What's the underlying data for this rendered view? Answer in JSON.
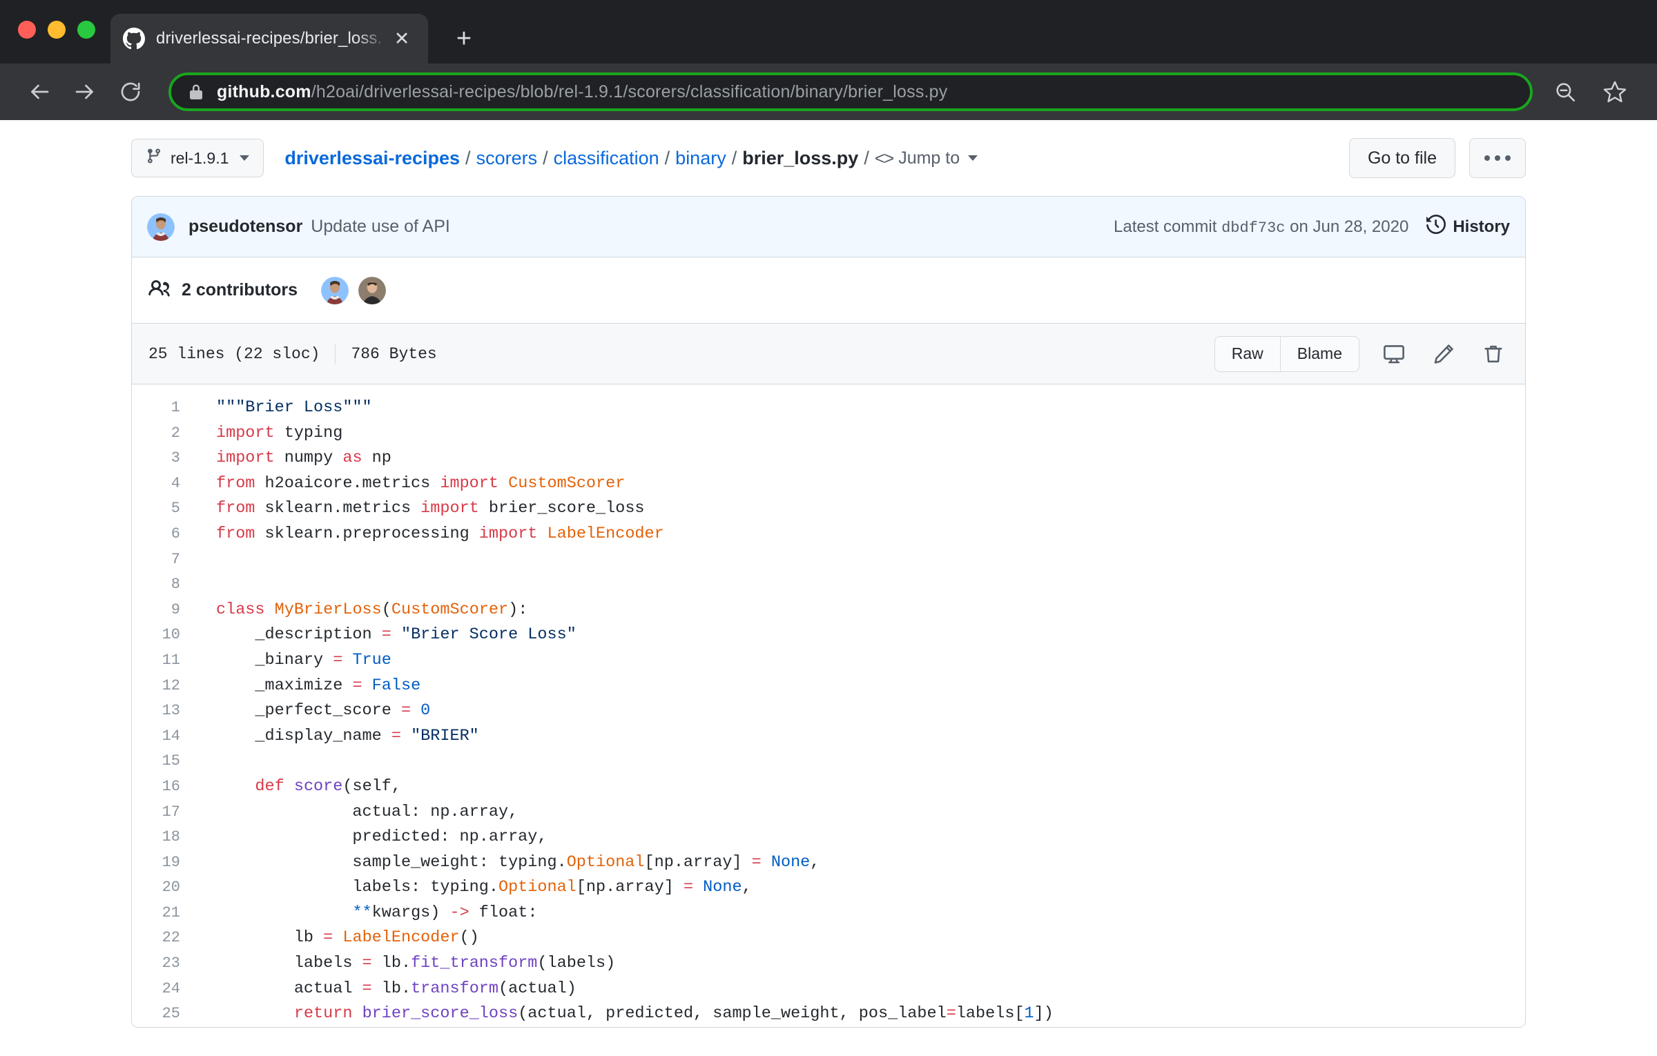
{
  "browser": {
    "tab": {
      "title": "driverlessai-recipes/brier_loss.",
      "favicon_name": "github-favicon",
      "close_label": "✕"
    },
    "new_tab_label": "+",
    "nav": {
      "back": "←",
      "forward": "→",
      "reload": "⟳"
    },
    "omnibox": {
      "host": "github.com",
      "path": "/h2oai/driverlessai-recipes/blob/rel-1.9.1/scorers/classification/binary/brier_loss.py",
      "lock_icon": "lock-icon",
      "highlight_color": "#19a51e"
    },
    "toolbar_icons": [
      "zoom-out-icon",
      "bookmark-star-icon"
    ]
  },
  "page": {
    "branch_selector": {
      "label": "rel-1.9.1",
      "icon": "branch-icon"
    },
    "breadcrumb": {
      "repo": "driverlessai-recipes",
      "segments": [
        "scorers",
        "classification",
        "binary"
      ],
      "file": "brier_loss.py",
      "separator": "/",
      "jump_to": "Jump to"
    },
    "actions": {
      "go_to_file": "Go to file",
      "more": "…"
    },
    "commit": {
      "author": "pseudotensor",
      "message": "Update use of API",
      "latest_commit_prefix": "Latest commit",
      "sha": "dbdf73c",
      "date": "on Jun 28, 2020",
      "history_label": "History"
    },
    "contributors": {
      "count_label": "2 contributors",
      "icon": "people-icon"
    },
    "file_meta": {
      "lines": "25 lines (22 sloc)",
      "size": "786 Bytes",
      "raw": "Raw",
      "blame": "Blame",
      "desktop_icon": "desktop-download-icon",
      "edit_icon": "pencil-icon",
      "delete_icon": "trash-icon"
    },
    "code": {
      "language": "python",
      "lines": [
        {
          "n": "1",
          "tokens": [
            {
              "t": "\"\"\"Brier Loss\"\"\"",
              "c": "s"
            }
          ]
        },
        {
          "n": "2",
          "tokens": [
            {
              "t": "import",
              "c": "k"
            },
            {
              "t": " typing",
              "c": ""
            }
          ]
        },
        {
          "n": "3",
          "tokens": [
            {
              "t": "import",
              "c": "k"
            },
            {
              "t": " numpy ",
              "c": ""
            },
            {
              "t": "as",
              "c": "k"
            },
            {
              "t": " np",
              "c": ""
            }
          ]
        },
        {
          "n": "4",
          "tokens": [
            {
              "t": "from",
              "c": "k"
            },
            {
              "t": " h2oaicore.metrics ",
              "c": ""
            },
            {
              "t": "import",
              "c": "k"
            },
            {
              "t": " ",
              "c": ""
            },
            {
              "t": "CustomScorer",
              "c": "cls"
            }
          ]
        },
        {
          "n": "5",
          "tokens": [
            {
              "t": "from",
              "c": "k"
            },
            {
              "t": " sklearn.metrics ",
              "c": ""
            },
            {
              "t": "import",
              "c": "k"
            },
            {
              "t": " brier_score_loss",
              "c": ""
            }
          ]
        },
        {
          "n": "6",
          "tokens": [
            {
              "t": "from",
              "c": "k"
            },
            {
              "t": " sklearn.preprocessing ",
              "c": ""
            },
            {
              "t": "import",
              "c": "k"
            },
            {
              "t": " ",
              "c": ""
            },
            {
              "t": "LabelEncoder",
              "c": "cls"
            }
          ]
        },
        {
          "n": "7",
          "tokens": []
        },
        {
          "n": "8",
          "tokens": []
        },
        {
          "n": "9",
          "tokens": [
            {
              "t": "class",
              "c": "k"
            },
            {
              "t": " ",
              "c": ""
            },
            {
              "t": "MyBrierLoss",
              "c": "cls"
            },
            {
              "t": "(",
              "c": ""
            },
            {
              "t": "CustomScorer",
              "c": "cls"
            },
            {
              "t": "):",
              "c": ""
            }
          ]
        },
        {
          "n": "10",
          "tokens": [
            {
              "t": "    _description ",
              "c": ""
            },
            {
              "t": "=",
              "c": "op"
            },
            {
              "t": " ",
              "c": ""
            },
            {
              "t": "\"Brier Score Loss\"",
              "c": "s"
            }
          ]
        },
        {
          "n": "11",
          "tokens": [
            {
              "t": "    _binary ",
              "c": ""
            },
            {
              "t": "=",
              "c": "op"
            },
            {
              "t": " ",
              "c": ""
            },
            {
              "t": "True",
              "c": "cn"
            }
          ]
        },
        {
          "n": "12",
          "tokens": [
            {
              "t": "    _maximize ",
              "c": ""
            },
            {
              "t": "=",
              "c": "op"
            },
            {
              "t": " ",
              "c": ""
            },
            {
              "t": "False",
              "c": "cn"
            }
          ]
        },
        {
          "n": "13",
          "tokens": [
            {
              "t": "    _perfect_score ",
              "c": ""
            },
            {
              "t": "=",
              "c": "op"
            },
            {
              "t": " ",
              "c": ""
            },
            {
              "t": "0",
              "c": "cn"
            }
          ]
        },
        {
          "n": "14",
          "tokens": [
            {
              "t": "    _display_name ",
              "c": ""
            },
            {
              "t": "=",
              "c": "op"
            },
            {
              "t": " ",
              "c": ""
            },
            {
              "t": "\"BRIER\"",
              "c": "s"
            }
          ]
        },
        {
          "n": "15",
          "tokens": []
        },
        {
          "n": "16",
          "tokens": [
            {
              "t": "    ",
              "c": ""
            },
            {
              "t": "def",
              "c": "k"
            },
            {
              "t": " ",
              "c": ""
            },
            {
              "t": "score",
              "c": "fn"
            },
            {
              "t": "(self,",
              "c": ""
            }
          ]
        },
        {
          "n": "17",
          "tokens": [
            {
              "t": "              actual: np.array,",
              "c": ""
            }
          ]
        },
        {
          "n": "18",
          "tokens": [
            {
              "t": "              predicted: np.array,",
              "c": ""
            }
          ]
        },
        {
          "n": "19",
          "tokens": [
            {
              "t": "              sample_weight: typing.",
              "c": ""
            },
            {
              "t": "Optional",
              "c": "cls"
            },
            {
              "t": "[np.array] ",
              "c": ""
            },
            {
              "t": "=",
              "c": "op"
            },
            {
              "t": " ",
              "c": ""
            },
            {
              "t": "None",
              "c": "cn"
            },
            {
              "t": ",",
              "c": ""
            }
          ]
        },
        {
          "n": "20",
          "tokens": [
            {
              "t": "              labels: typing.",
              "c": ""
            },
            {
              "t": "Optional",
              "c": "cls"
            },
            {
              "t": "[np.array] ",
              "c": ""
            },
            {
              "t": "=",
              "c": "op"
            },
            {
              "t": " ",
              "c": ""
            },
            {
              "t": "None",
              "c": "cn"
            },
            {
              "t": ",",
              "c": ""
            }
          ]
        },
        {
          "n": "21",
          "tokens": [
            {
              "t": "              ",
              "c": ""
            },
            {
              "t": "**",
              "c": "cn"
            },
            {
              "t": "kwargs) ",
              "c": ""
            },
            {
              "t": "->",
              "c": "op"
            },
            {
              "t": " float:",
              "c": ""
            }
          ]
        },
        {
          "n": "22",
          "tokens": [
            {
              "t": "        lb ",
              "c": ""
            },
            {
              "t": "=",
              "c": "op"
            },
            {
              "t": " ",
              "c": ""
            },
            {
              "t": "LabelEncoder",
              "c": "cls"
            },
            {
              "t": "()",
              "c": ""
            }
          ]
        },
        {
          "n": "23",
          "tokens": [
            {
              "t": "        labels ",
              "c": ""
            },
            {
              "t": "=",
              "c": "op"
            },
            {
              "t": " lb.",
              "c": ""
            },
            {
              "t": "fit_transform",
              "c": "fn"
            },
            {
              "t": "(labels)",
              "c": ""
            }
          ]
        },
        {
          "n": "24",
          "tokens": [
            {
              "t": "        actual ",
              "c": ""
            },
            {
              "t": "=",
              "c": "op"
            },
            {
              "t": " lb.",
              "c": ""
            },
            {
              "t": "transform",
              "c": "fn"
            },
            {
              "t": "(actual)",
              "c": ""
            }
          ]
        },
        {
          "n": "25",
          "tokens": [
            {
              "t": "        ",
              "c": ""
            },
            {
              "t": "return",
              "c": "k"
            },
            {
              "t": " ",
              "c": ""
            },
            {
              "t": "brier_score_loss",
              "c": "fn"
            },
            {
              "t": "(actual, predicted, sample_weight, pos_label",
              "c": ""
            },
            {
              "t": "=",
              "c": "op"
            },
            {
              "t": "labels[",
              "c": ""
            },
            {
              "t": "1",
              "c": "cn"
            },
            {
              "t": "])",
              "c": ""
            }
          ]
        }
      ]
    }
  },
  "colors": {
    "link": "#0969da",
    "keyword": "#d73a49",
    "string": "#032f62",
    "class": "#e36209",
    "function": "#6f42c1",
    "constant": "#005cc5",
    "commit_bg": "#f1f8ff",
    "chrome_bg": "#35363a"
  }
}
